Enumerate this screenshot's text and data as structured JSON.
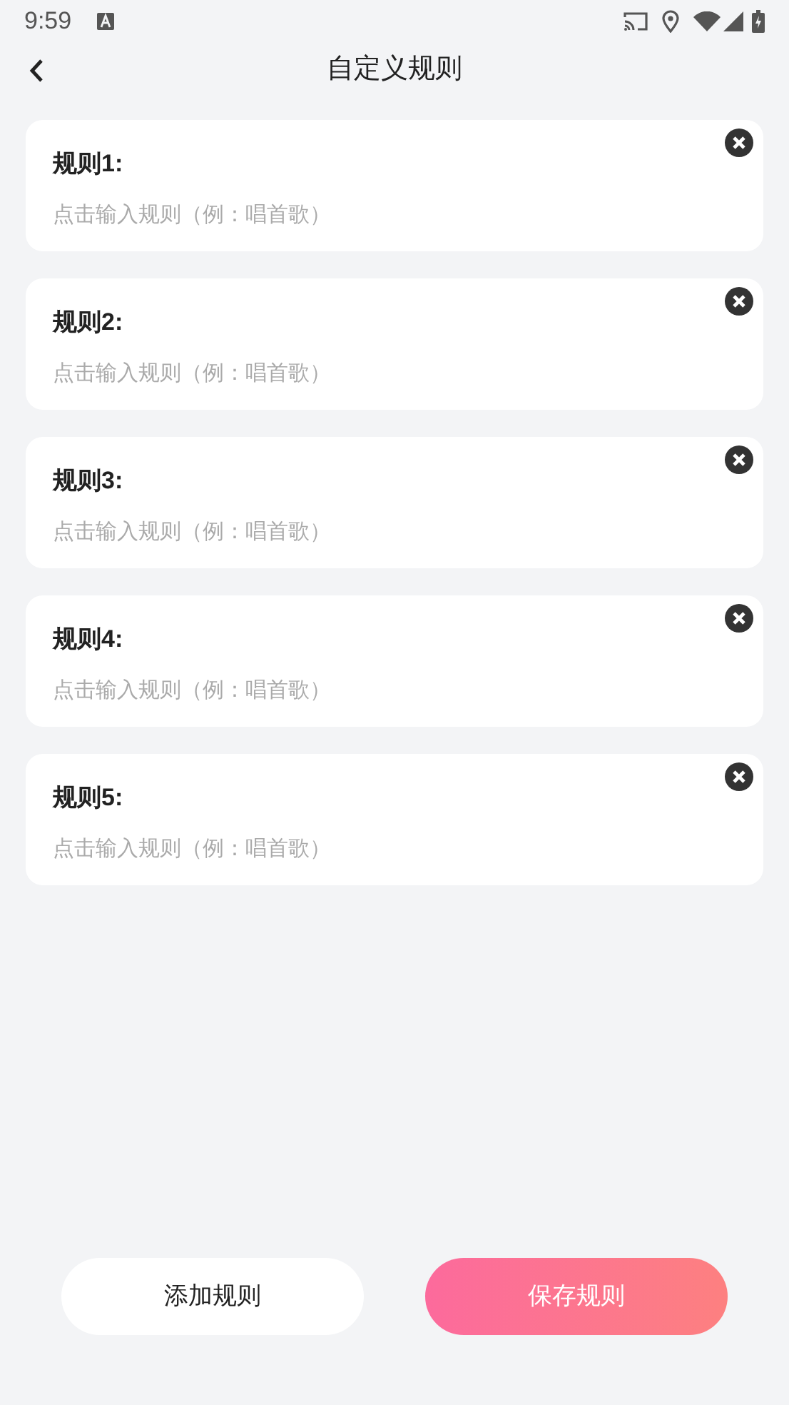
{
  "status_bar": {
    "time": "9:59"
  },
  "header": {
    "title": "自定义规则"
  },
  "rules": [
    {
      "label": "规则1:",
      "placeholder": "点击输入规则（例：唱首歌）"
    },
    {
      "label": "规则2:",
      "placeholder": "点击输入规则（例：唱首歌）"
    },
    {
      "label": "规则3:",
      "placeholder": "点击输入规则（例：唱首歌）"
    },
    {
      "label": "规则4:",
      "placeholder": "点击输入规则（例：唱首歌）"
    },
    {
      "label": "规则5:",
      "placeholder": "点击输入规则（例：唱首歌）"
    }
  ],
  "buttons": [
    {
      "label": "添加规则",
      "kind": "secondary"
    },
    {
      "label": "保存规则",
      "kind": "primary"
    }
  ]
}
